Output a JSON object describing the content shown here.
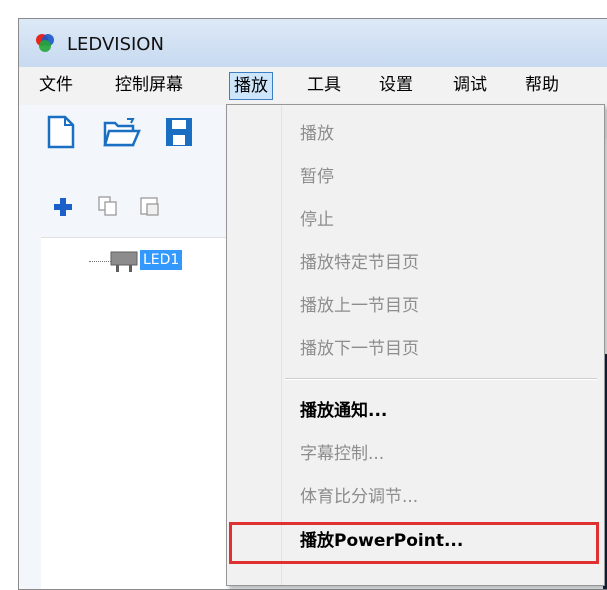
{
  "window": {
    "title": "LEDVISION"
  },
  "menubar": {
    "items": [
      "文件",
      "控制屏幕",
      "播放",
      "工具",
      "设置",
      "调试",
      "帮助"
    ]
  },
  "toolbar": {
    "icons": [
      "new-file-icon",
      "open-folder-icon",
      "save-icon"
    ]
  },
  "subtoolbar": {
    "icons": [
      "add-icon",
      "copy-icon",
      "paste-icon"
    ]
  },
  "tree": {
    "items": [
      {
        "label": "LED1",
        "icon": "led-screen-icon",
        "selected": true
      }
    ]
  },
  "play_menu": {
    "items": [
      {
        "label": "播放",
        "enabled": false
      },
      {
        "label": "暂停",
        "enabled": false
      },
      {
        "label": "停止",
        "enabled": false
      },
      {
        "label": "播放特定节目页",
        "enabled": false
      },
      {
        "label": "播放上一节目页",
        "enabled": false
      },
      {
        "label": "播放下一节目页",
        "enabled": false
      },
      {
        "label": "播放通知...",
        "enabled": true
      },
      {
        "label": "字幕控制...",
        "enabled": false
      },
      {
        "label": "体育比分调节...",
        "enabled": false
      },
      {
        "label": "播放PowerPoint...",
        "enabled": true,
        "highlighted": true
      }
    ]
  },
  "colors": {
    "highlight_border": "#e03131",
    "selection": "#3399ff",
    "accent": "#1f78c8"
  }
}
